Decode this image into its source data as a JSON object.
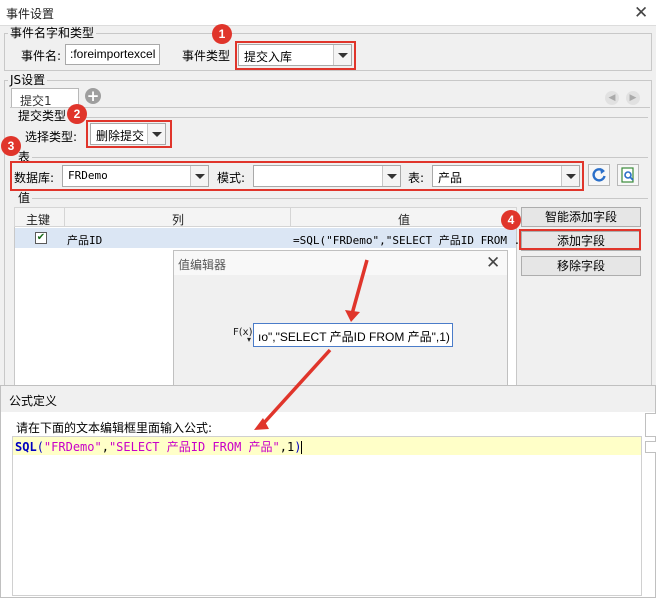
{
  "window": {
    "title": "事件设置",
    "close_label": "X"
  },
  "event_section": {
    "legend": "事件名字和类型",
    "name_label": "事件名:",
    "name_value": ":foreimportexcel",
    "type_label": "事件类型",
    "type_value": "提交入库"
  },
  "js_section": {
    "legend": "JS设置",
    "tab_label": "提交1",
    "add_tab_label": "+",
    "submit_type_legend": "提交类型",
    "select_type_label": "选择类型:",
    "select_type_value": "删除提交"
  },
  "table_section": {
    "legend": "表",
    "database_label": "数据库:",
    "database_value": "FRDemo",
    "schema_label": "模式:",
    "schema_value": "",
    "table_label": "表:",
    "table_value": "产品"
  },
  "value_section": {
    "legend": "值",
    "columns": [
      "主键",
      "列",
      "值"
    ],
    "rows": [
      {
        "primary_key_checked": true,
        "column": "产品ID",
        "value": "=SQL(\"FRDemo\",\"SELECT 产品ID FROM ..."
      }
    ],
    "buttons": {
      "smart_add": "智能添加字段",
      "add": "添加字段",
      "remove": "移除字段"
    }
  },
  "value_editor": {
    "title": "值编辑器",
    "close_label": "X",
    "fx_label": "F(x)",
    "formula_display": "ıo\",\"SELECT 产品ID FROM 产品\",1)"
  },
  "formula_dialog": {
    "title": "公式定义",
    "instruction": "请在下面的文本编辑框里面输入公式:",
    "formula_parts": {
      "fn": "SQL",
      "open": "(",
      "arg1": "\"FRDemo\"",
      "comma1": ",",
      "arg2": "\"SELECT 产品ID FROM 产品\"",
      "comma2": ",",
      "arg3": "1",
      "close": ")"
    }
  },
  "annotations": {
    "badge1": "1",
    "badge2": "2",
    "badge3": "3",
    "badge4": "4"
  },
  "colors": {
    "annotation_red": "#e0352b",
    "formula_highlight": "#ffffc8",
    "string_magenta": "#c800c8",
    "function_blue": "#0000c0",
    "selected_row": "#dbe6f4"
  }
}
